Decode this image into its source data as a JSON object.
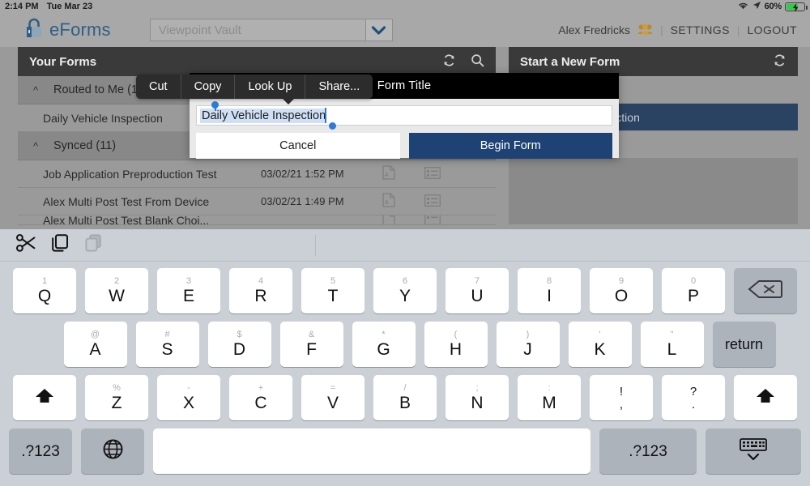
{
  "statusbar": {
    "time": "2:14 PM",
    "date": "Tue Mar 23",
    "battery_pct": "60%",
    "wifi_icon": "wifi-icon",
    "location_icon": "location-arrow-icon",
    "battery_icon": "battery-charging-icon"
  },
  "header": {
    "brand": "eForms",
    "lock_icon": "lock-icon",
    "vault_value": "Viewpoint Vault",
    "vault_caret_icon": "chevron-down-icon",
    "user_name": "Alex Fredricks",
    "people_icon": "people-icon",
    "settings": "SETTINGS",
    "logout": "LOGOUT",
    "separator": "|"
  },
  "left_panel": {
    "title": "Your Forms",
    "refresh_icon": "refresh-icon",
    "search_icon": "search-icon",
    "groups": [
      {
        "label": "Routed to Me (1)",
        "chevron": "chevron-up-icon"
      },
      {
        "label": "Synced (11)",
        "chevron": "chevron-up-icon"
      }
    ],
    "routed_rows": [
      {
        "name": "Daily Vehicle Inspection",
        "date": "",
        "pdf_icon": "",
        "detail_icon": ""
      }
    ],
    "synced_rows": [
      {
        "name": "Job Application Preproduction Test",
        "date": "03/02/21 1:52 PM",
        "pdf_icon": "pdf-icon",
        "detail_icon": "detail-icon"
      },
      {
        "name": "Alex Multi Post Test From Device",
        "date": "03/02/21 1:49 PM",
        "pdf_icon": "pdf-icon",
        "detail_icon": "detail-icon"
      },
      {
        "name": "Alex Multi Post Test Blank Choi...",
        "date": "",
        "pdf_icon": "pdf-icon",
        "detail_icon": "detail-icon"
      }
    ]
  },
  "right_panel": {
    "title": "Start a New Form",
    "refresh_icon": "refresh-icon",
    "rows": [
      {
        "name": "",
        "selected": false
      },
      {
        "name": "Daily Vehicle Inspection",
        "selected": true
      },
      {
        "name": "",
        "selected": false
      }
    ]
  },
  "dialog": {
    "title": "Form Title",
    "input_value": "Daily Vehicle Inspection",
    "cancel_label": "Cancel",
    "begin_label": "Begin Form",
    "accent_color": "#1d4273",
    "selection_color": "#cfe0f5",
    "handle_color": "#2d7ad9"
  },
  "callout": {
    "items": [
      "Cut",
      "Copy",
      "Look Up",
      "Share..."
    ]
  },
  "keyboard": {
    "toolbar": {
      "cut_icon": "scissors-icon",
      "copy_icon": "copy-icon",
      "paste_icon": "paste-icon-disabled"
    },
    "row1": [
      {
        "alt": "1",
        "main": "Q"
      },
      {
        "alt": "2",
        "main": "W"
      },
      {
        "alt": "3",
        "main": "E"
      },
      {
        "alt": "4",
        "main": "R"
      },
      {
        "alt": "5",
        "main": "T"
      },
      {
        "alt": "6",
        "main": "Y"
      },
      {
        "alt": "7",
        "main": "U"
      },
      {
        "alt": "8",
        "main": "I"
      },
      {
        "alt": "9",
        "main": "O"
      },
      {
        "alt": "0",
        "main": "P"
      }
    ],
    "backspace_icon": "backspace-icon",
    "row2": [
      {
        "alt": "@",
        "main": "A"
      },
      {
        "alt": "#",
        "main": "S"
      },
      {
        "alt": "$",
        "main": "D"
      },
      {
        "alt": "&",
        "main": "F"
      },
      {
        "alt": "*",
        "main": "G"
      },
      {
        "alt": "(",
        "main": "H"
      },
      {
        "alt": ")",
        "main": "J"
      },
      {
        "alt": "'",
        "main": "K"
      },
      {
        "alt": "\"",
        "main": "L"
      }
    ],
    "return_label": "return",
    "row3": [
      {
        "alt": "%",
        "main": "Z"
      },
      {
        "alt": "-",
        "main": "X"
      },
      {
        "alt": "+",
        "main": "C"
      },
      {
        "alt": "=",
        "main": "V"
      },
      {
        "alt": "/",
        "main": "B"
      },
      {
        "alt": ";",
        "main": "N"
      },
      {
        "alt": ":",
        "main": "M"
      }
    ],
    "dual_keys": [
      {
        "top": "!",
        "bottom": ","
      },
      {
        "top": "?",
        "bottom": "."
      }
    ],
    "shift_left_icon": "shift-up-icon",
    "shift_right_icon": "shift-up-icon",
    "numeric_left": ".?123",
    "globe_icon": "globe-icon",
    "space_label": "",
    "numeric_right": ".?123",
    "hide_keyboard_icon": "hide-keyboard-icon"
  }
}
